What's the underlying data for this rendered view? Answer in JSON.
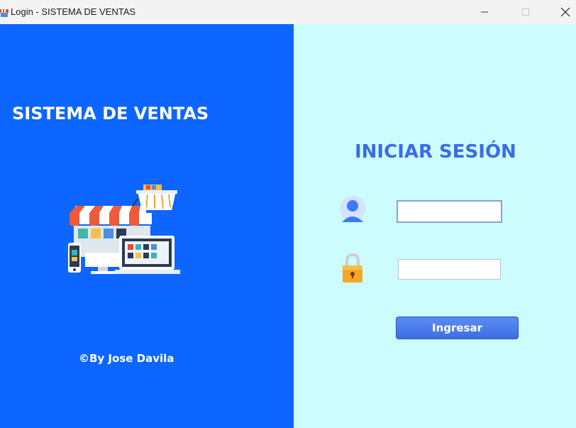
{
  "window": {
    "title": "Login - SISTEMA DE VENTAS",
    "icon": "app-store-icon"
  },
  "left": {
    "brand_title": "SISTEMA DE VENTAS",
    "illustration": "online-store-illustration",
    "author": "©By Jose Davila",
    "bg_color": "#0d66ff"
  },
  "right": {
    "heading": "INICIAR SESIÓN",
    "user_icon": "user-avatar-icon",
    "lock_icon": "padlock-icon",
    "username_value": "",
    "password_value": "",
    "submit_label": "Ingresar",
    "bg_color": "#ccfcfd",
    "accent_color": "#3b6ce8"
  }
}
